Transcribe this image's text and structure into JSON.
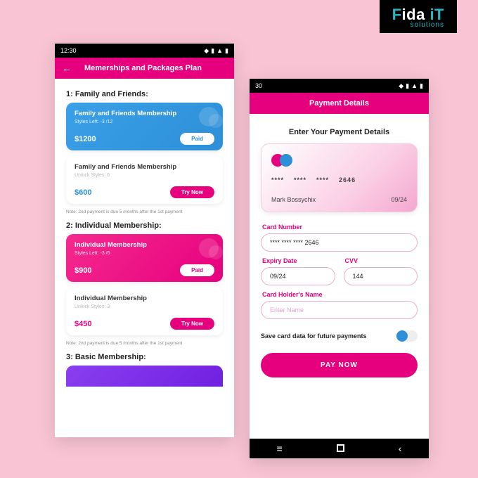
{
  "logo": {
    "brand_a": "F",
    "brand_b": "ida ",
    "brand_c": "iT",
    "sub": "solutions"
  },
  "statusbar": {
    "time": "12:30",
    "time2": "30"
  },
  "left": {
    "header": "Memerships and Packages Plan",
    "sections": [
      {
        "title": "1: Family and Friends:",
        "cards": [
          {
            "title": "Family and Friends Membership",
            "sub": "Styles Left: -3 /12",
            "price": "$1200",
            "badge": "Paid"
          },
          {
            "title": "Family and Friends Membership",
            "sub": "Unlock Styles: 6",
            "price": "$600",
            "badge": "Try Now"
          }
        ],
        "note": "Note: 2nd payment is due 5 months after the 1st payment"
      },
      {
        "title": "2: Individual Membership:",
        "cards": [
          {
            "title": "Individual Membership",
            "sub": "Styles Left: -3 /6",
            "price": "$900",
            "badge": "Paid"
          },
          {
            "title": "Individual Membership",
            "sub": "Unlock Styles: 3",
            "price": "$450",
            "badge": "Try Now"
          }
        ],
        "note": "Note: 2nd payment is due 5 months after the 1st payment"
      },
      {
        "title": "3: Basic Membership:"
      }
    ]
  },
  "right": {
    "header": "Payment Details",
    "title": "Enter Your Payment Details",
    "card": {
      "masked_groups": [
        "****",
        "****",
        "****"
      ],
      "last4": "2646",
      "name": "Mark Bossychix",
      "expiry": "09/24"
    },
    "fields": {
      "card_number_label": "Card Number",
      "card_number_value": "****  ****  ****  2646",
      "expiry_label": "Expiry Date",
      "expiry_value": "09/24",
      "cvv_label": "CVV",
      "cvv_value": "144",
      "holder_label": "Card Holder's Name",
      "holder_placeholder": "Enter Name"
    },
    "save_label": "Save card data for future payments",
    "pay_button": "PAY NOW"
  }
}
